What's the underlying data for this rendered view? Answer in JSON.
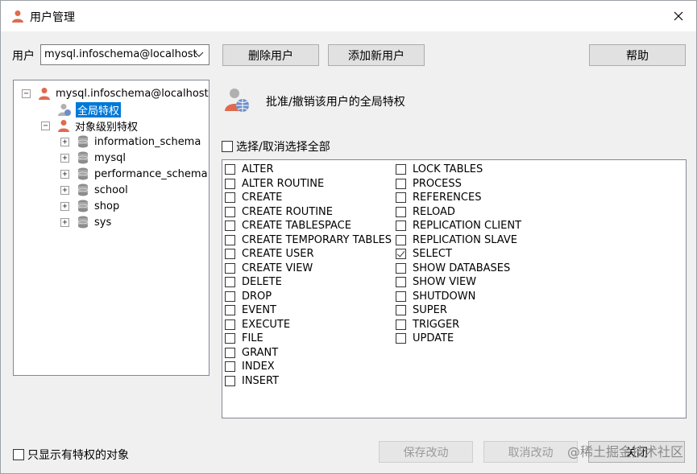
{
  "window": {
    "title": "用户管理"
  },
  "toolbar": {
    "user_label": "用户",
    "user_value": "mysql.infoschema@localhost",
    "delete_user": "删除用户",
    "add_user": "添加新用户",
    "help": "帮助"
  },
  "tree": {
    "root": "mysql.infoschema@localhost",
    "global_privileges": "全局特权",
    "object_privileges": "对象级别特权",
    "databases": [
      "information_schema",
      "mysql",
      "performance_schema",
      "school",
      "shop",
      "sys"
    ]
  },
  "header": {
    "description": "批准/撤销该用户的全局特权"
  },
  "select_all": {
    "label": "选择/取消选择全部"
  },
  "privileges": {
    "col1": [
      "ALTER",
      "ALTER ROUTINE",
      "CREATE",
      "CREATE ROUTINE",
      "CREATE TABLESPACE",
      "CREATE TEMPORARY TABLES",
      "CREATE USER",
      "CREATE VIEW",
      "DELETE",
      "DROP",
      "EVENT",
      "EXECUTE",
      "FILE",
      "GRANT",
      "INDEX",
      "INSERT"
    ],
    "col2": [
      "LOCK TABLES",
      "PROCESS",
      "REFERENCES",
      "RELOAD",
      "REPLICATION CLIENT",
      "REPLICATION SLAVE",
      "SELECT",
      "SHOW DATABASES",
      "SHOW VIEW",
      "SHUTDOWN",
      "SUPER",
      "TRIGGER",
      "UPDATE"
    ],
    "checked": [
      "SELECT"
    ]
  },
  "footer": {
    "show_only": "只显示有特权的对象",
    "save": "保存改动",
    "cancel": "取消改动",
    "close": "关闭"
  },
  "watermark": "@稀土掘金技术社区"
}
